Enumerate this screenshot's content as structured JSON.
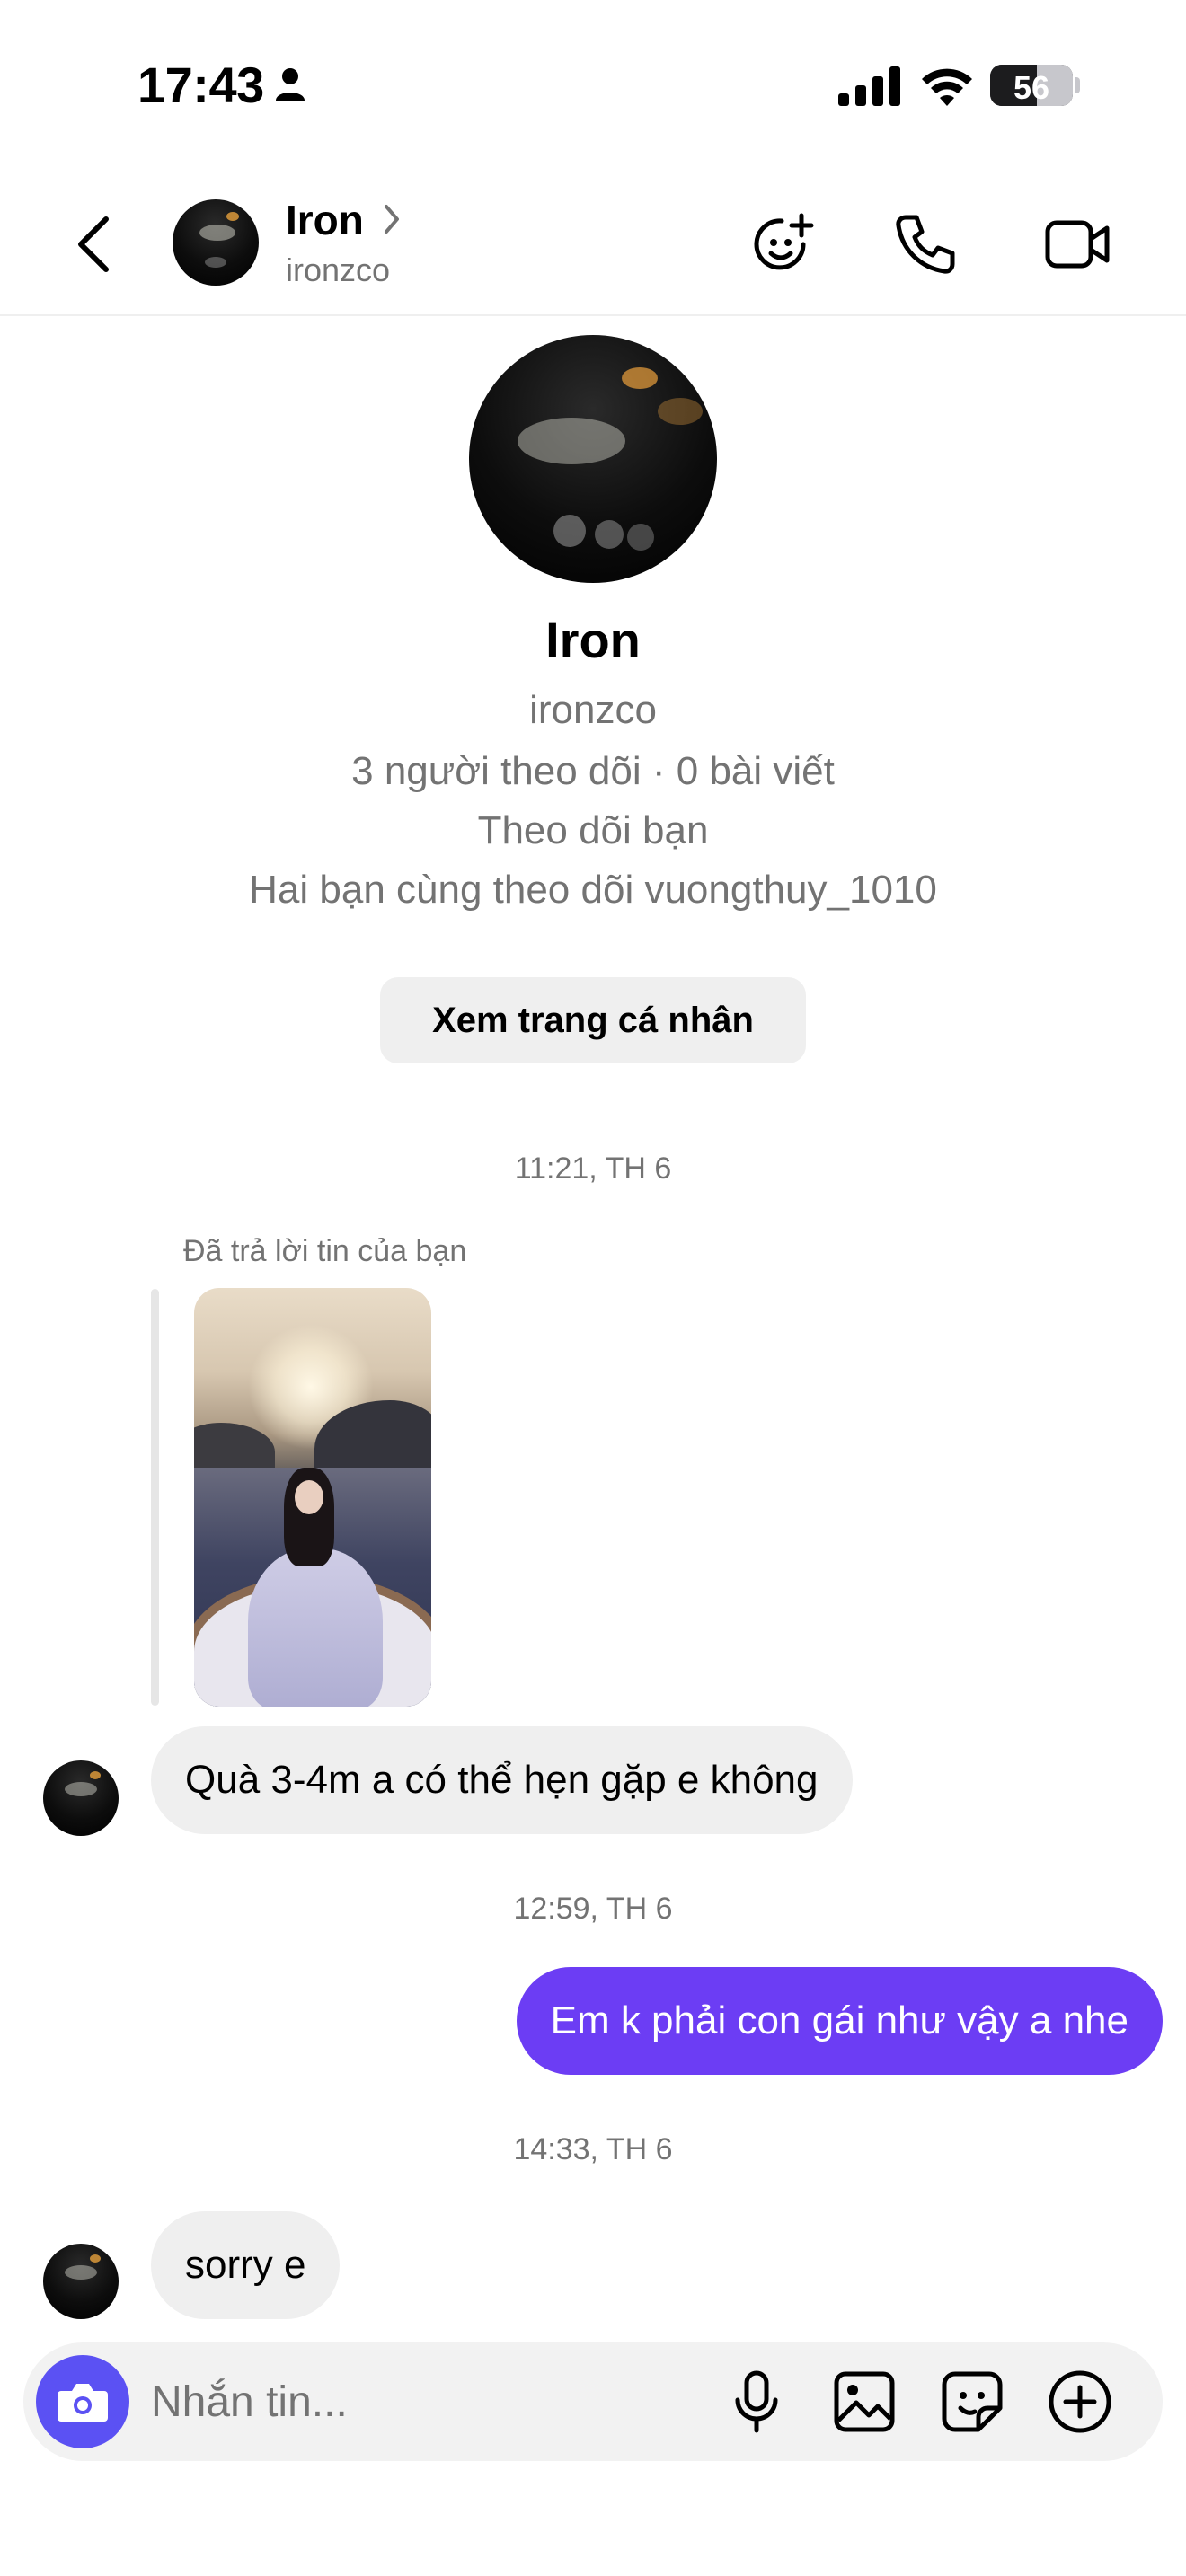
{
  "status_bar": {
    "time": "17:43",
    "battery": "56",
    "battery_level": 0.56
  },
  "header": {
    "name": "Iron",
    "username": "ironzco"
  },
  "profile": {
    "name": "Iron",
    "username": "ironzco",
    "stats": "3 người theo dõi · 0 bài viết",
    "follows_you": "Theo dõi bạn",
    "mutual": "Hai bạn cùng theo dõi vuongthuy_1010",
    "view_profile_label": "Xem trang cá nhân"
  },
  "messages": [
    {
      "type": "timestamp",
      "text": "11:21, TH 6"
    },
    {
      "type": "story_reply_label",
      "text": "Đã trả lời tin của bạn"
    },
    {
      "type": "incoming",
      "text": "Quà 3-4m a có thể hẹn gặp e không"
    },
    {
      "type": "timestamp",
      "text": "12:59, TH 6"
    },
    {
      "type": "outgoing",
      "text": "Em k phải con gái như vậy a nhe"
    },
    {
      "type": "timestamp",
      "text": "14:33, TH 6"
    },
    {
      "type": "incoming",
      "text": "sorry e"
    }
  ],
  "composer": {
    "placeholder": "Nhắn tin..."
  },
  "colors": {
    "accent": "#6c3df4",
    "camera_button": "#5b51f3",
    "secondary_text": "#737373",
    "bubble_in": "#efefef"
  },
  "icons": [
    "back-icon",
    "chevron-right-icon",
    "add-emoji-icon",
    "phone-icon",
    "video-icon",
    "camera-icon",
    "microphone-icon",
    "image-icon",
    "sticker-icon",
    "plus-icon"
  ]
}
